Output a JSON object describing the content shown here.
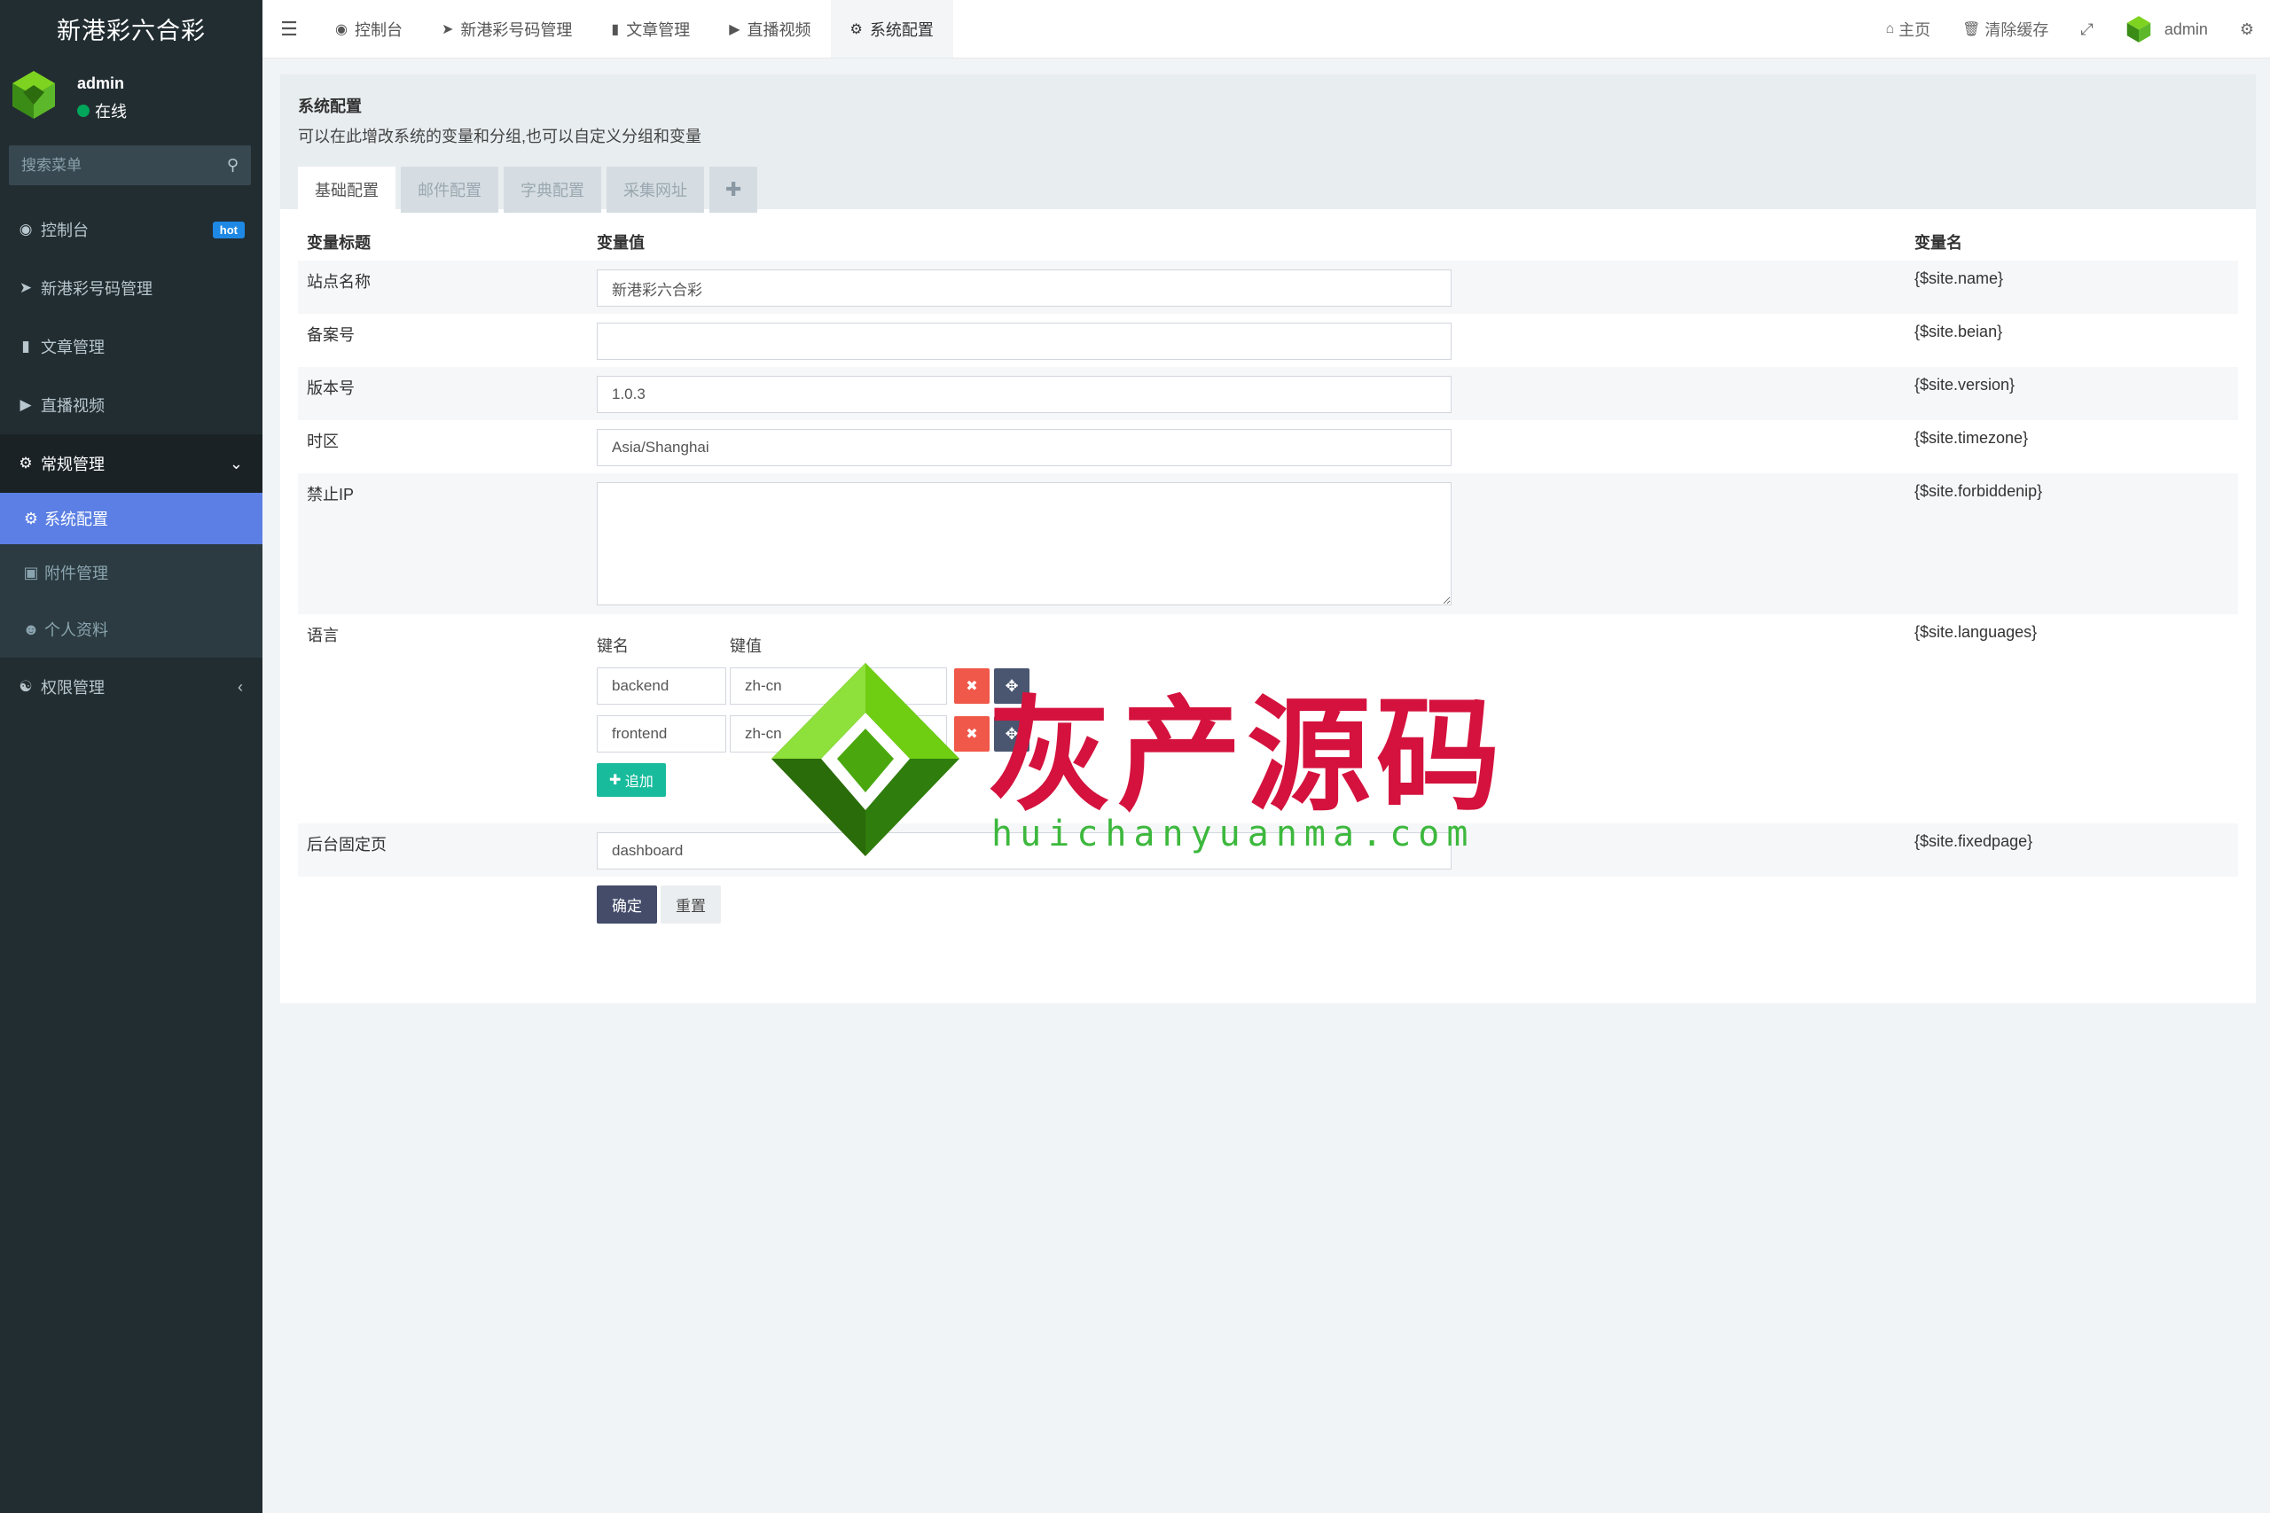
{
  "brand": "新港彩六合彩",
  "user": {
    "name": "admin",
    "status": "在线"
  },
  "search": {
    "placeholder": "搜索菜单"
  },
  "sidebar": {
    "items": [
      {
        "label": "控制台",
        "icon": "dashboard-icon",
        "badge": "hot"
      },
      {
        "label": "新港彩号码管理",
        "icon": "location-arrow-icon"
      },
      {
        "label": "文章管理",
        "icon": "bookmark-icon"
      },
      {
        "label": "直播视频",
        "icon": "video-icon"
      },
      {
        "label": "常规管理",
        "icon": "cogs-icon"
      },
      {
        "label": "权限管理",
        "icon": "users-icon"
      }
    ],
    "submenu": [
      {
        "label": "系统配置",
        "icon": "gear-icon"
      },
      {
        "label": "附件管理",
        "icon": "image-icon"
      },
      {
        "label": "个人资料",
        "icon": "user-icon"
      }
    ]
  },
  "topnav": {
    "tabs": [
      "控制台",
      "新港彩号码管理",
      "文章管理",
      "直播视频",
      "系统配置"
    ],
    "home": "主页",
    "clear_cache": "清除缓存",
    "admin": "admin"
  },
  "panel": {
    "title": "系统配置",
    "desc": "可以在此增改系统的变量和分组,也可以自定义分组和变量",
    "tabs": [
      "基础配置",
      "邮件配置",
      "字典配置",
      "采集网址"
    ]
  },
  "table": {
    "headers": [
      "变量标题",
      "变量值",
      "变量名"
    ],
    "rows": [
      {
        "title": "站点名称",
        "value": "新港彩六合彩",
        "var": "{$site.name}"
      },
      {
        "title": "备案号",
        "value": "",
        "var": "{$site.beian}"
      },
      {
        "title": "版本号",
        "value": "1.0.3",
        "var": "{$site.version}"
      },
      {
        "title": "时区",
        "value": "Asia/Shanghai",
        "var": "{$site.timezone}"
      },
      {
        "title": "禁止IP",
        "value": "",
        "var": "{$site.forbiddenip}"
      },
      {
        "title": "语言",
        "var": "{$site.languages}"
      },
      {
        "title": "后台固定页",
        "value": "dashboard",
        "var": "{$site.fixedpage}"
      }
    ],
    "lang": {
      "key_label": "键名",
      "value_label": "键值",
      "pairs": [
        {
          "key": "backend",
          "value": "zh-cn"
        },
        {
          "key": "frontend",
          "value": "zh-cn"
        }
      ],
      "add_label": "追加"
    }
  },
  "buttons": {
    "ok": "确定",
    "reset": "重置"
  },
  "watermark": {
    "text": "灰产源码",
    "url": "huichanyuanma.com"
  },
  "colors": {
    "sidebar": "#222d32",
    "active": "#5b7fe4",
    "hot": "#1e88e5",
    "danger": "#f0584a",
    "success": "#18bc9c",
    "primary": "#444c6a"
  }
}
